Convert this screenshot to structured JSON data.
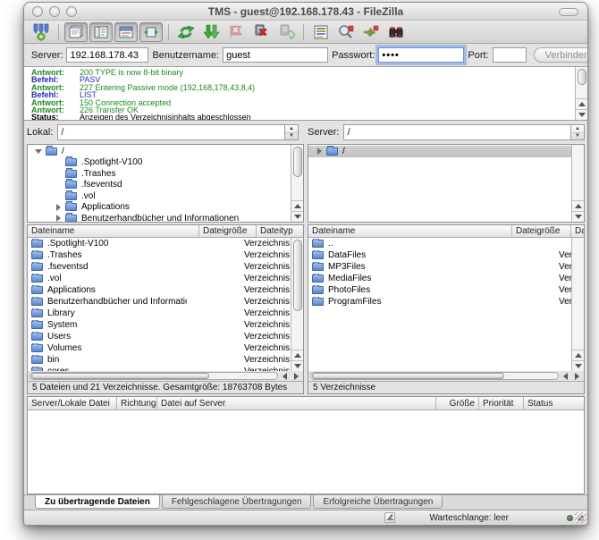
{
  "window": {
    "title": "TMS - guest@192.168.178.43 - FileZilla"
  },
  "toolbar": {
    "icons": [
      "site-manager",
      "toggle-message-log",
      "toggle-local-tree",
      "toggle-remote-tree",
      "toggle-transfer-queue",
      "refresh",
      "process-queue",
      "cancel-operation",
      "disconnect",
      "reconnect",
      "directory-listing-filter",
      "directory-comparison",
      "synchronized-browsing",
      "file-search"
    ]
  },
  "quickconnect": {
    "server_label": "Server:",
    "server_value": "192.168.178.43",
    "user_label": "Benutzername:",
    "user_value": "guest",
    "password_label": "Passwort:",
    "password_value": "••••",
    "port_label": "Port:",
    "port_value": "",
    "connect_label": "Verbinden"
  },
  "log": {
    "lines": [
      {
        "label": "Antwort:",
        "text": "200 TYPE is now 8-bit binary",
        "type": "response"
      },
      {
        "label": "Befehl:",
        "text": "PASV",
        "type": "command"
      },
      {
        "label": "Antwort:",
        "text": "227 Entering Passive mode (192,168,178,43,8,4)",
        "type": "response"
      },
      {
        "label": "Befehl:",
        "text": "LIST",
        "type": "command"
      },
      {
        "label": "Antwort:",
        "text": "150 Connection accepted",
        "type": "response"
      },
      {
        "label": "Antwort:",
        "text": "226 Transfer OK",
        "type": "response"
      },
      {
        "label": "Status:",
        "text": "Anzeigen des Verzeichnisinhalts abgeschlossen",
        "type": "status"
      }
    ]
  },
  "local": {
    "path_label": "Lokal:",
    "path_value": "/",
    "tree": [
      {
        "indent": 0,
        "arrow": "down",
        "label": "/"
      },
      {
        "indent": 1,
        "arrow": "",
        "label": ".Spotlight-V100"
      },
      {
        "indent": 1,
        "arrow": "",
        "label": ".Trashes"
      },
      {
        "indent": 1,
        "arrow": "",
        "label": ".fseventsd"
      },
      {
        "indent": 1,
        "arrow": "",
        "label": ".vol"
      },
      {
        "indent": 1,
        "arrow": "right",
        "label": "Applications"
      },
      {
        "indent": 1,
        "arrow": "right",
        "label": "Benutzerhandbücher und Informationen"
      }
    ],
    "columns": [
      "Dateiname",
      "Dateigröße",
      "Dateityp"
    ],
    "files": [
      {
        "name": ".Spotlight-V100",
        "size": "",
        "type": "Verzeichnis"
      },
      {
        "name": ".Trashes",
        "size": "",
        "type": "Verzeichnis"
      },
      {
        "name": ".fseventsd",
        "size": "",
        "type": "Verzeichnis"
      },
      {
        "name": ".vol",
        "size": "",
        "type": "Verzeichnis"
      },
      {
        "name": "Applications",
        "size": "",
        "type": "Verzeichnis"
      },
      {
        "name": "Benutzerhandbücher und Informationen",
        "size": "",
        "type": "Verzeichnis"
      },
      {
        "name": "Library",
        "size": "",
        "type": "Verzeichnis"
      },
      {
        "name": "System",
        "size": "",
        "type": "Verzeichnis"
      },
      {
        "name": "Users",
        "size": "",
        "type": "Verzeichnis"
      },
      {
        "name": "Volumes",
        "size": "",
        "type": "Verzeichnis"
      },
      {
        "name": "bin",
        "size": "",
        "type": "Verzeichnis"
      },
      {
        "name": "cores",
        "size": "",
        "type": "Verzeichnis"
      }
    ],
    "status": "5 Dateien und 21 Verzeichnisse. Gesamtgröße: 18763708 Bytes"
  },
  "remote": {
    "path_label": "Server:",
    "path_value": "/",
    "tree": [
      {
        "indent": 0,
        "arrow": "right",
        "label": "/",
        "selected": true
      }
    ],
    "columns": [
      "Dateiname",
      "Dateigröße",
      "Dateityp"
    ],
    "files": [
      {
        "name": "..",
        "size": "",
        "type": ""
      },
      {
        "name": "DataFiles",
        "size": "",
        "type": "Verzeichnis"
      },
      {
        "name": "MP3Files",
        "size": "",
        "type": "Verzeichnis"
      },
      {
        "name": "MediaFiles",
        "size": "",
        "type": "Verzeichnis"
      },
      {
        "name": "PhotoFiles",
        "size": "",
        "type": "Verzeichnis"
      },
      {
        "name": "ProgramFiles",
        "size": "",
        "type": "Verzeichnis"
      }
    ],
    "status": "5 Verzeichnisse"
  },
  "queue": {
    "columns": [
      "Server/Lokale Datei",
      "Richtung",
      "Datei auf Server",
      "Größe",
      "Priorität",
      "Status"
    ]
  },
  "tabs": [
    {
      "label": "Zu übertragende Dateien",
      "active": true
    },
    {
      "label": "Fehlgeschlagene Übertragungen",
      "active": false
    },
    {
      "label": "Erfolgreiche Übertragungen",
      "active": false
    }
  ],
  "statusbar": {
    "queue_text": "Warteschlange: leer"
  },
  "colors": {
    "response_green": "#1e8a1e",
    "command_blue": "#2929b8",
    "folder_blue": "#5c86cc",
    "led_green": "#2f6d2a",
    "led_red": "#8f2f28"
  }
}
